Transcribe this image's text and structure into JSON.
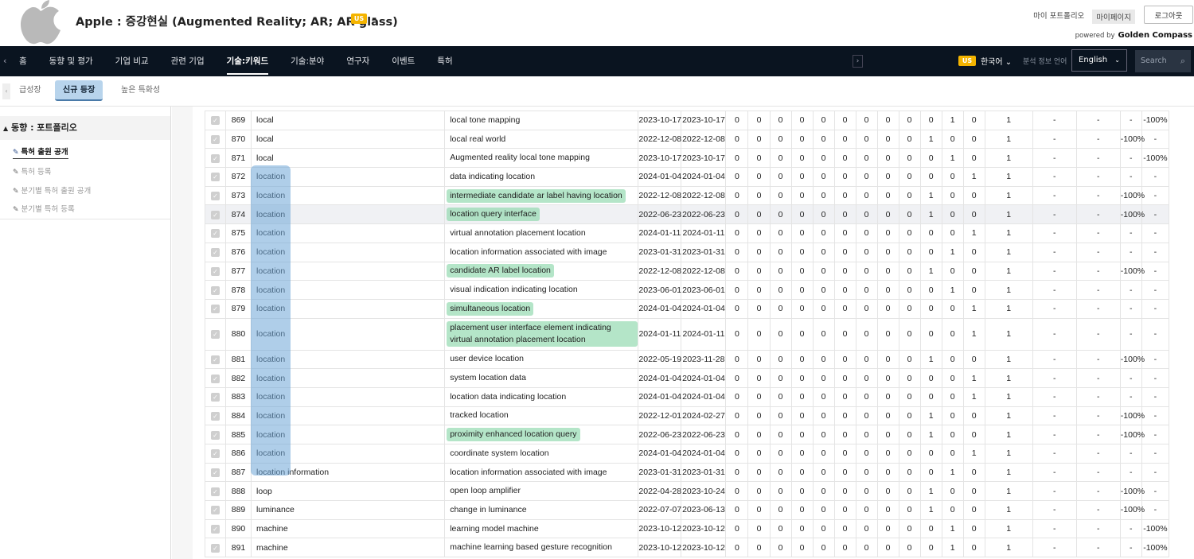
{
  "header": {
    "company": "Apple",
    "title": "Apple :  증강현실 (Augmented Reality; AR; AR glass)",
    "badge": "US",
    "dash": "-",
    "links": [
      "마이 포트폴리오",
      "마이페이지"
    ],
    "logout": "로그아웃",
    "powered_by": "powered by",
    "brand": "Golden Compass"
  },
  "nav": {
    "items": [
      "홈",
      "동향 및 평가",
      "기업 비교",
      "관련 기업",
      "기술:키워드",
      "기술:분야",
      "연구자",
      "이벤트",
      "특허"
    ],
    "active_index": 4,
    "lang_badge": "US",
    "lang_label": "한국어 ⌄",
    "analysis_label": "분석 정보 언어",
    "english": "English",
    "search_placeholder": "Search"
  },
  "subtabs": {
    "items": [
      "급성장",
      "신규 등장",
      "높은 특화성"
    ],
    "active_index": 1
  },
  "sidebar": {
    "heading": "동향 : 포트폴리오",
    "items": [
      "특허 출원 공개",
      "특허 등록",
      "분기별 특허 출원 공개",
      "분기별 특허 등록"
    ],
    "active_index": 0
  },
  "colors": {
    "nav_bg": "#0a1420",
    "badge": "#f4b400",
    "tab_active": "#b8d4ec",
    "highlight_green": "#8cd7aa",
    "highlight_blue": "#6ea5d7"
  },
  "table": {
    "rows": [
      [
        "869",
        "local",
        "local tone mapping",
        "2023-10-17",
        "2023-10-17",
        "0",
        "0",
        "0",
        "0",
        "0",
        "0",
        "0",
        "0",
        "0",
        "0",
        "1",
        "0",
        "1",
        "-",
        "-",
        "-",
        "-100%"
      ],
      [
        "870",
        "local",
        "local real world",
        "2022-12-08",
        "2022-12-08",
        "0",
        "0",
        "0",
        "0",
        "0",
        "0",
        "0",
        "0",
        "0",
        "1",
        "0",
        "0",
        "1",
        "-",
        "-",
        "-100%",
        "-"
      ],
      [
        "871",
        "local",
        "Augmented reality local tone mapping",
        "2023-10-17",
        "2023-10-17",
        "0",
        "0",
        "0",
        "0",
        "0",
        "0",
        "0",
        "0",
        "0",
        "0",
        "1",
        "0",
        "1",
        "-",
        "-",
        "-",
        "-100%"
      ],
      [
        "872",
        "location",
        "data indicating location",
        "2024-01-04",
        "2024-01-04",
        "0",
        "0",
        "0",
        "0",
        "0",
        "0",
        "0",
        "0",
        "0",
        "0",
        "0",
        "1",
        "1",
        "-",
        "-",
        "-",
        "-"
      ],
      [
        "873",
        "location",
        "intermediate candidate ar label having location",
        "2022-12-08",
        "2022-12-08",
        "0",
        "0",
        "0",
        "0",
        "0",
        "0",
        "0",
        "0",
        "0",
        "1",
        "0",
        "0",
        "1",
        "-",
        "-",
        "-100%",
        "-"
      ],
      [
        "874",
        "location",
        "location query interface",
        "2022-06-23",
        "2022-06-23",
        "0",
        "0",
        "0",
        "0",
        "0",
        "0",
        "0",
        "0",
        "0",
        "1",
        "0",
        "0",
        "1",
        "-",
        "-",
        "-100%",
        "-"
      ],
      [
        "875",
        "location",
        "virtual annotation placement location",
        "2024-01-11",
        "2024-01-11",
        "0",
        "0",
        "0",
        "0",
        "0",
        "0",
        "0",
        "0",
        "0",
        "0",
        "0",
        "1",
        "1",
        "-",
        "-",
        "-",
        "-"
      ],
      [
        "876",
        "location",
        "location information associated with image",
        "2023-01-31",
        "2023-01-31",
        "0",
        "0",
        "0",
        "0",
        "0",
        "0",
        "0",
        "0",
        "0",
        "0",
        "1",
        "0",
        "1",
        "-",
        "-",
        "-",
        "-"
      ],
      [
        "877",
        "location",
        "candidate AR label location",
        "2022-12-08",
        "2022-12-08",
        "0",
        "0",
        "0",
        "0",
        "0",
        "0",
        "0",
        "0",
        "0",
        "1",
        "0",
        "0",
        "1",
        "-",
        "-",
        "-100%",
        "-"
      ],
      [
        "878",
        "location",
        "visual indication indicating location",
        "2023-06-01",
        "2023-06-01",
        "0",
        "0",
        "0",
        "0",
        "0",
        "0",
        "0",
        "0",
        "0",
        "0",
        "1",
        "0",
        "1",
        "-",
        "-",
        "-",
        "-"
      ],
      [
        "879",
        "location",
        "simultaneous location",
        "2024-01-04",
        "2024-01-04",
        "0",
        "0",
        "0",
        "0",
        "0",
        "0",
        "0",
        "0",
        "0",
        "0",
        "0",
        "1",
        "1",
        "-",
        "-",
        "-",
        "-"
      ],
      [
        "880",
        "location",
        "placement user interface element indicating virtual annotation placement location",
        "2024-01-11",
        "2024-01-11",
        "0",
        "0",
        "0",
        "0",
        "0",
        "0",
        "0",
        "0",
        "0",
        "0",
        "0",
        "1",
        "1",
        "-",
        "-",
        "-",
        "-"
      ],
      [
        "881",
        "location",
        "user device location",
        "2022-05-19",
        "2023-11-28",
        "0",
        "0",
        "0",
        "0",
        "0",
        "0",
        "0",
        "0",
        "0",
        "1",
        "0",
        "0",
        "1",
        "-",
        "-",
        "-100%",
        "-"
      ],
      [
        "882",
        "location",
        "system location data",
        "2024-01-04",
        "2024-01-04",
        "0",
        "0",
        "0",
        "0",
        "0",
        "0",
        "0",
        "0",
        "0",
        "0",
        "0",
        "1",
        "1",
        "-",
        "-",
        "-",
        "-"
      ],
      [
        "883",
        "location",
        "location data indicating location",
        "2024-01-04",
        "2024-01-04",
        "0",
        "0",
        "0",
        "0",
        "0",
        "0",
        "0",
        "0",
        "0",
        "0",
        "0",
        "1",
        "1",
        "-",
        "-",
        "-",
        "-"
      ],
      [
        "884",
        "location",
        "tracked location",
        "2022-12-01",
        "2024-02-27",
        "0",
        "0",
        "0",
        "0",
        "0",
        "0",
        "0",
        "0",
        "0",
        "1",
        "0",
        "0",
        "1",
        "-",
        "-",
        "-100%",
        "-"
      ],
      [
        "885",
        "location",
        "proximity enhanced location query",
        "2022-06-23",
        "2022-06-23",
        "0",
        "0",
        "0",
        "0",
        "0",
        "0",
        "0",
        "0",
        "0",
        "1",
        "0",
        "0",
        "1",
        "-",
        "-",
        "-100%",
        "-"
      ],
      [
        "886",
        "location",
        "coordinate system location",
        "2024-01-04",
        "2024-01-04",
        "0",
        "0",
        "0",
        "0",
        "0",
        "0",
        "0",
        "0",
        "0",
        "0",
        "0",
        "1",
        "1",
        "-",
        "-",
        "-",
        "-"
      ],
      [
        "887",
        "location information",
        "location information associated with image",
        "2023-01-31",
        "2023-01-31",
        "0",
        "0",
        "0",
        "0",
        "0",
        "0",
        "0",
        "0",
        "0",
        "0",
        "1",
        "0",
        "1",
        "-",
        "-",
        "-",
        "-"
      ],
      [
        "888",
        "loop",
        "open loop amplifier",
        "2022-04-28",
        "2023-10-24",
        "0",
        "0",
        "0",
        "0",
        "0",
        "0",
        "0",
        "0",
        "0",
        "1",
        "0",
        "0",
        "1",
        "-",
        "-",
        "-100%",
        "-"
      ],
      [
        "889",
        "luminance",
        "change in luminance",
        "2022-07-07",
        "2023-06-13",
        "0",
        "0",
        "0",
        "0",
        "0",
        "0",
        "0",
        "0",
        "0",
        "1",
        "0",
        "0",
        "1",
        "-",
        "-",
        "-100%",
        "-"
      ],
      [
        "890",
        "machine",
        "learning model machine",
        "2023-10-12",
        "2023-10-12",
        "0",
        "0",
        "0",
        "0",
        "0",
        "0",
        "0",
        "0",
        "0",
        "0",
        "1",
        "0",
        "1",
        "-",
        "-",
        "-",
        "-100%"
      ],
      [
        "891",
        "machine",
        "machine learning based gesture recognition",
        "2023-10-12",
        "2023-10-12",
        "0",
        "0",
        "0",
        "0",
        "0",
        "0",
        "0",
        "0",
        "0",
        "0",
        "1",
        "0",
        "1",
        "-",
        "-",
        "-",
        "-100%"
      ]
    ],
    "green_rows": [
      "873",
      "874",
      "877",
      "879",
      "880",
      "885"
    ],
    "hover_row": "874",
    "tall_row": "880"
  }
}
